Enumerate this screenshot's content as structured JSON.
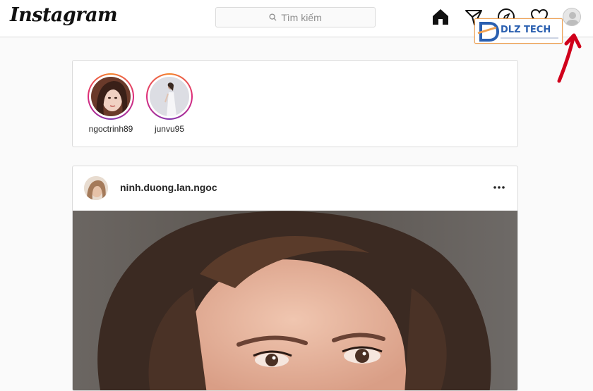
{
  "header": {
    "logo": "Instagram",
    "search_placeholder": "Tìm kiếm",
    "nav_icons": [
      "home-icon",
      "direct-message-icon",
      "explore-compass-icon",
      "activity-heart-icon",
      "profile-avatar-icon"
    ]
  },
  "watermark": {
    "text": "DLZ TECH",
    "letter": "D"
  },
  "stories": [
    {
      "username": "ngoctrinh89"
    },
    {
      "username": "junvu95"
    }
  ],
  "post": {
    "username": "ninh.duong.lan.ngoc",
    "more_icon": "more-dots-icon"
  },
  "colors": {
    "accent_ring": "#dd2a7b",
    "border": "#dbdbdb",
    "background": "#fafafa",
    "annotation_arrow": "#d0001b",
    "watermark_blue": "#2a5fb0",
    "watermark_orange": "#f0a050"
  }
}
